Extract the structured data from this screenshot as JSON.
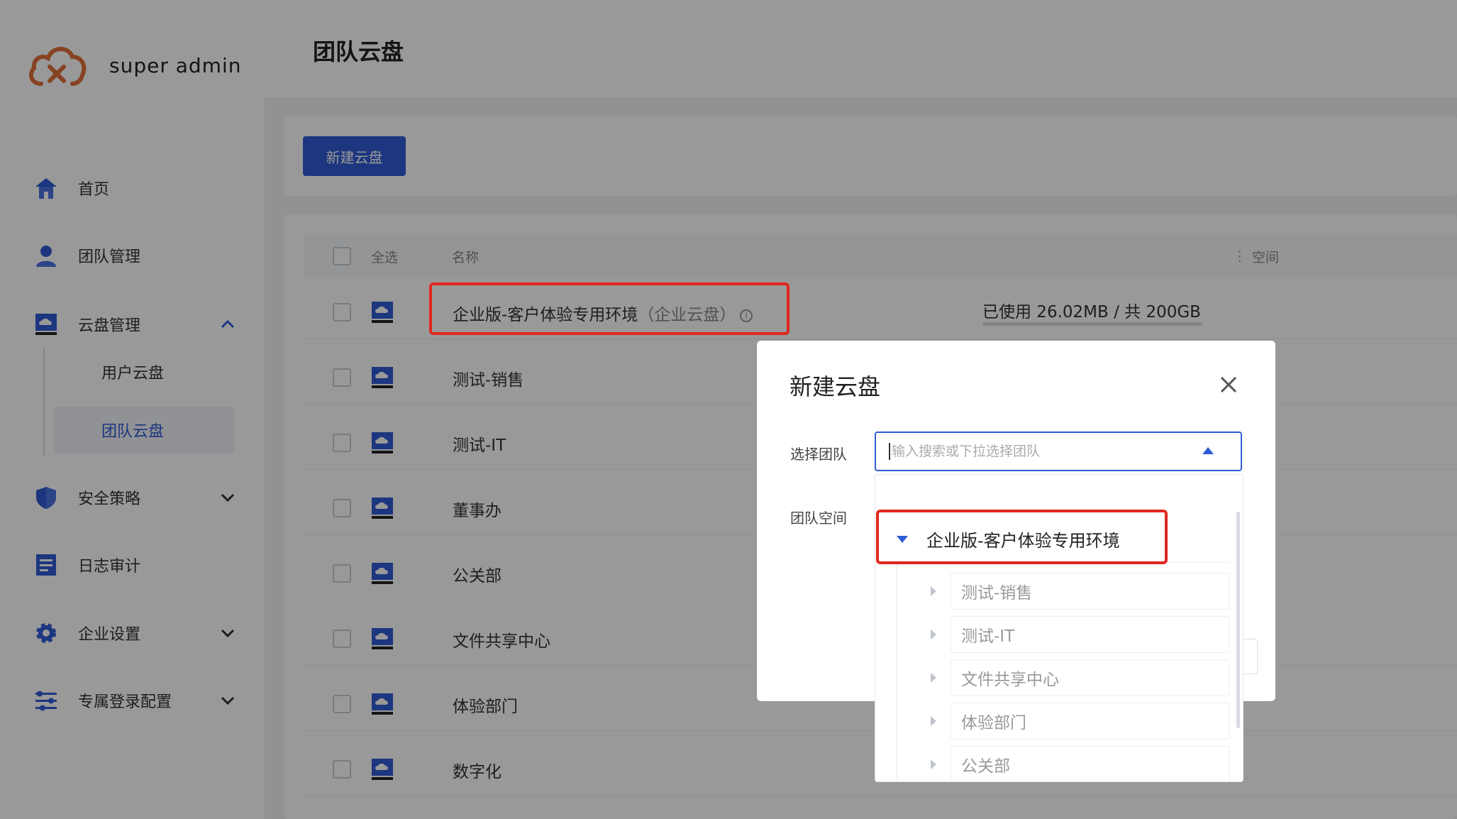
{
  "brand": {
    "name": "super admin",
    "logo": "cloud-logo"
  },
  "colors": {
    "primary": "#2f5bd4",
    "highlight": "#e0271f",
    "logo": "#e0703a"
  },
  "sidebar": {
    "items": [
      {
        "label": "首页",
        "icon": "home-icon"
      },
      {
        "label": "团队管理",
        "icon": "user-icon"
      },
      {
        "label": "云盘管理",
        "icon": "cloud-disk-icon",
        "expanded": true,
        "children": [
          {
            "label": "用户云盘"
          },
          {
            "label": "团队云盘",
            "active": true
          }
        ]
      },
      {
        "label": "安全策略",
        "icon": "shield-icon"
      },
      {
        "label": "日志审计",
        "icon": "log-icon"
      },
      {
        "label": "企业设置",
        "icon": "gear-icon"
      },
      {
        "label": "专属登录配置",
        "icon": "sliders-icon"
      }
    ]
  },
  "header": {
    "title": "团队云盘"
  },
  "toolbar": {
    "new_label": "新建云盘"
  },
  "table": {
    "select_all": "全选",
    "col_name": "名称",
    "col_space": "空间",
    "rows": [
      {
        "name": "企业版-客户体验专用环境",
        "sub": "（企业云盘）",
        "space": "已使用 26.02MB / 共 200GB"
      },
      {
        "name": "测试-销售"
      },
      {
        "name": "测试-IT"
      },
      {
        "name": "董事办"
      },
      {
        "name": "公关部"
      },
      {
        "name": "文件共享中心"
      },
      {
        "name": "体验部门"
      },
      {
        "name": "数字化"
      }
    ]
  },
  "modal": {
    "title": "新建云盘",
    "label_team": "选择团队",
    "label_space": "团队空间",
    "placeholder": "输入搜索或下拉选择团队"
  },
  "dropdown": {
    "root": "企业版-客户体验专用环境",
    "children": [
      "测试-销售",
      "测试-IT",
      "文件共享中心",
      "体验部门",
      "公关部"
    ]
  }
}
